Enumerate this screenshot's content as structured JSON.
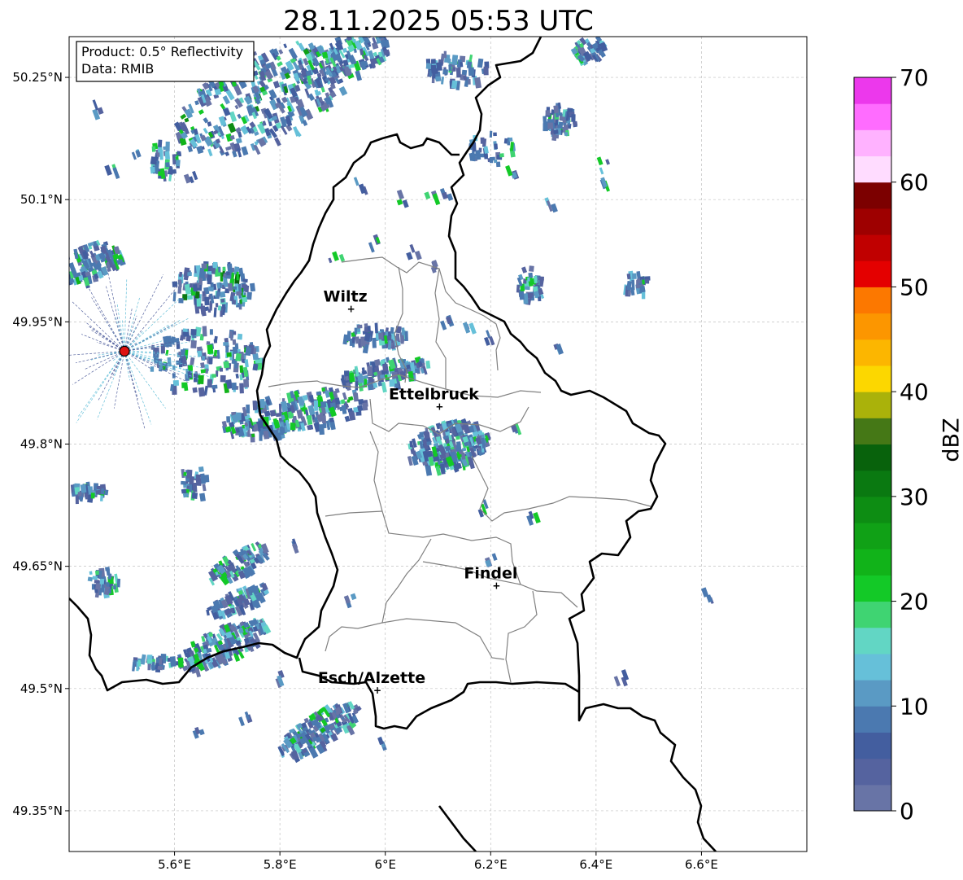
{
  "title": "28.11.2025 05:53 UTC",
  "info_box": {
    "product": "Product: 0.5° Reflectivity",
    "data": "Data: RMIB"
  },
  "axes": {
    "lon_ticks": [
      {
        "value": 5.6,
        "label": "5.6°E"
      },
      {
        "value": 5.8,
        "label": "5.8°E"
      },
      {
        "value": 6.0,
        "label": "6°E"
      },
      {
        "value": 6.2,
        "label": "6.2°E"
      },
      {
        "value": 6.4,
        "label": "6.4°E"
      },
      {
        "value": 6.6,
        "label": "6.6°E"
      }
    ],
    "lat_ticks": [
      {
        "value": 50.25,
        "label": "50.25°N"
      },
      {
        "value": 50.1,
        "label": "50.1°N"
      },
      {
        "value": 49.95,
        "label": "49.95°N"
      },
      {
        "value": 49.8,
        "label": "49.8°N"
      },
      {
        "value": 49.65,
        "label": "49.65°N"
      },
      {
        "value": 49.5,
        "label": "49.5°N"
      },
      {
        "value": 49.35,
        "label": "49.35°N"
      }
    ],
    "lon_range": [
      5.4,
      6.8
    ],
    "lat_range": [
      49.3,
      50.3
    ],
    "grid": true
  },
  "cities": [
    {
      "name": "Wiltz",
      "lon": 5.935,
      "lat": 49.966
    },
    {
      "name": "Ettelbruck",
      "lon": 6.103,
      "lat": 49.846
    },
    {
      "name": "Findel",
      "lon": 6.211,
      "lat": 49.626
    },
    {
      "name": "Esch/Alzette",
      "lon": 5.985,
      "lat": 49.498
    }
  ],
  "radar_site": {
    "lon": 5.505,
    "lat": 49.914,
    "color": "#dd1111"
  },
  "colorbar": {
    "label": "dBZ",
    "min": 0,
    "max": 70,
    "step": 2.5,
    "tick_values": [
      0,
      10,
      20,
      30,
      40,
      50,
      60,
      70
    ],
    "tick_labels": [
      "0",
      "10",
      "20",
      "30",
      "40",
      "50",
      "60",
      "70"
    ],
    "colors": [
      "#6874a6",
      "#55639f",
      "#435e9f",
      "#4b79b0",
      "#5a9ac4",
      "#66c0d9",
      "#62d6c4",
      "#3fd472",
      "#13c927",
      "#11b319",
      "#10a116",
      "#0d8d13",
      "#0a7911",
      "#08620c",
      "#457816",
      "#aab20a",
      "#fcd700",
      "#fcb600",
      "#fc9600",
      "#fc7800",
      "#e40000",
      "#c00000",
      "#9e0000",
      "#7c0000",
      "#ffdcff",
      "#ffb2ff",
      "#ff6cff",
      "#ec38ec"
    ]
  },
  "legend_colors": {
    "border_national": "#000000",
    "border_cantonal": "#808080",
    "grid": "#c0c0c0"
  }
}
